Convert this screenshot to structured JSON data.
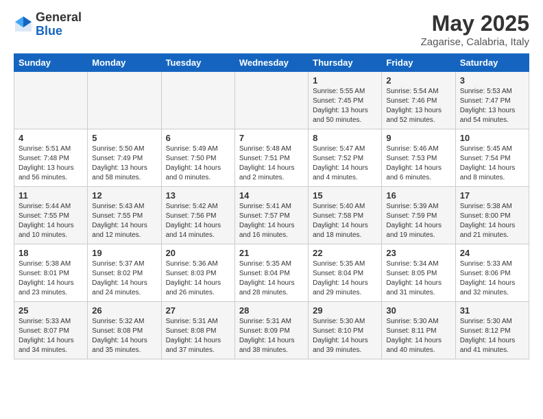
{
  "header": {
    "logo_general": "General",
    "logo_blue": "Blue",
    "month_title": "May 2025",
    "location": "Zagarise, Calabria, Italy"
  },
  "weekdays": [
    "Sunday",
    "Monday",
    "Tuesday",
    "Wednesday",
    "Thursday",
    "Friday",
    "Saturday"
  ],
  "weeks": [
    {
      "id": "week1",
      "days": [
        {
          "num": "",
          "info": ""
        },
        {
          "num": "",
          "info": ""
        },
        {
          "num": "",
          "info": ""
        },
        {
          "num": "",
          "info": ""
        },
        {
          "num": "1",
          "info": "Sunrise: 5:55 AM\nSunset: 7:45 PM\nDaylight: 13 hours\nand 50 minutes."
        },
        {
          "num": "2",
          "info": "Sunrise: 5:54 AM\nSunset: 7:46 PM\nDaylight: 13 hours\nand 52 minutes."
        },
        {
          "num": "3",
          "info": "Sunrise: 5:53 AM\nSunset: 7:47 PM\nDaylight: 13 hours\nand 54 minutes."
        }
      ]
    },
    {
      "id": "week2",
      "days": [
        {
          "num": "4",
          "info": "Sunrise: 5:51 AM\nSunset: 7:48 PM\nDaylight: 13 hours\nand 56 minutes."
        },
        {
          "num": "5",
          "info": "Sunrise: 5:50 AM\nSunset: 7:49 PM\nDaylight: 13 hours\nand 58 minutes."
        },
        {
          "num": "6",
          "info": "Sunrise: 5:49 AM\nSunset: 7:50 PM\nDaylight: 14 hours\nand 0 minutes."
        },
        {
          "num": "7",
          "info": "Sunrise: 5:48 AM\nSunset: 7:51 PM\nDaylight: 14 hours\nand 2 minutes."
        },
        {
          "num": "8",
          "info": "Sunrise: 5:47 AM\nSunset: 7:52 PM\nDaylight: 14 hours\nand 4 minutes."
        },
        {
          "num": "9",
          "info": "Sunrise: 5:46 AM\nSunset: 7:53 PM\nDaylight: 14 hours\nand 6 minutes."
        },
        {
          "num": "10",
          "info": "Sunrise: 5:45 AM\nSunset: 7:54 PM\nDaylight: 14 hours\nand 8 minutes."
        }
      ]
    },
    {
      "id": "week3",
      "days": [
        {
          "num": "11",
          "info": "Sunrise: 5:44 AM\nSunset: 7:55 PM\nDaylight: 14 hours\nand 10 minutes."
        },
        {
          "num": "12",
          "info": "Sunrise: 5:43 AM\nSunset: 7:55 PM\nDaylight: 14 hours\nand 12 minutes."
        },
        {
          "num": "13",
          "info": "Sunrise: 5:42 AM\nSunset: 7:56 PM\nDaylight: 14 hours\nand 14 minutes."
        },
        {
          "num": "14",
          "info": "Sunrise: 5:41 AM\nSunset: 7:57 PM\nDaylight: 14 hours\nand 16 minutes."
        },
        {
          "num": "15",
          "info": "Sunrise: 5:40 AM\nSunset: 7:58 PM\nDaylight: 14 hours\nand 18 minutes."
        },
        {
          "num": "16",
          "info": "Sunrise: 5:39 AM\nSunset: 7:59 PM\nDaylight: 14 hours\nand 19 minutes."
        },
        {
          "num": "17",
          "info": "Sunrise: 5:38 AM\nSunset: 8:00 PM\nDaylight: 14 hours\nand 21 minutes."
        }
      ]
    },
    {
      "id": "week4",
      "days": [
        {
          "num": "18",
          "info": "Sunrise: 5:38 AM\nSunset: 8:01 PM\nDaylight: 14 hours\nand 23 minutes."
        },
        {
          "num": "19",
          "info": "Sunrise: 5:37 AM\nSunset: 8:02 PM\nDaylight: 14 hours\nand 24 minutes."
        },
        {
          "num": "20",
          "info": "Sunrise: 5:36 AM\nSunset: 8:03 PM\nDaylight: 14 hours\nand 26 minutes."
        },
        {
          "num": "21",
          "info": "Sunrise: 5:35 AM\nSunset: 8:04 PM\nDaylight: 14 hours\nand 28 minutes."
        },
        {
          "num": "22",
          "info": "Sunrise: 5:35 AM\nSunset: 8:04 PM\nDaylight: 14 hours\nand 29 minutes."
        },
        {
          "num": "23",
          "info": "Sunrise: 5:34 AM\nSunset: 8:05 PM\nDaylight: 14 hours\nand 31 minutes."
        },
        {
          "num": "24",
          "info": "Sunrise: 5:33 AM\nSunset: 8:06 PM\nDaylight: 14 hours\nand 32 minutes."
        }
      ]
    },
    {
      "id": "week5",
      "days": [
        {
          "num": "25",
          "info": "Sunrise: 5:33 AM\nSunset: 8:07 PM\nDaylight: 14 hours\nand 34 minutes."
        },
        {
          "num": "26",
          "info": "Sunrise: 5:32 AM\nSunset: 8:08 PM\nDaylight: 14 hours\nand 35 minutes."
        },
        {
          "num": "27",
          "info": "Sunrise: 5:31 AM\nSunset: 8:08 PM\nDaylight: 14 hours\nand 37 minutes."
        },
        {
          "num": "28",
          "info": "Sunrise: 5:31 AM\nSunset: 8:09 PM\nDaylight: 14 hours\nand 38 minutes."
        },
        {
          "num": "29",
          "info": "Sunrise: 5:30 AM\nSunset: 8:10 PM\nDaylight: 14 hours\nand 39 minutes."
        },
        {
          "num": "30",
          "info": "Sunrise: 5:30 AM\nSunset: 8:11 PM\nDaylight: 14 hours\nand 40 minutes."
        },
        {
          "num": "31",
          "info": "Sunrise: 5:30 AM\nSunset: 8:12 PM\nDaylight: 14 hours\nand 41 minutes."
        }
      ]
    }
  ]
}
